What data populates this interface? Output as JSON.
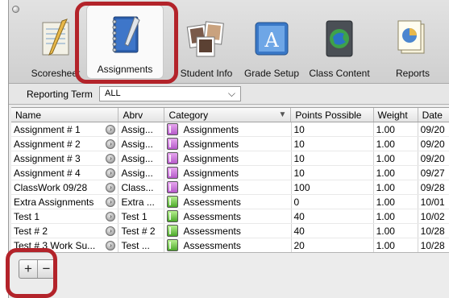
{
  "toolbar": {
    "items": [
      {
        "label": "Scoresheet",
        "icon": "scoresheet-icon"
      },
      {
        "label": "Assignments",
        "icon": "notebook-icon",
        "selected": true
      },
      {
        "label": "Student Info",
        "icon": "student-photos-icon"
      },
      {
        "label": "Grade Setup",
        "icon": "grade-setup-icon"
      },
      {
        "label": "Class Content",
        "icon": "class-content-icon"
      },
      {
        "label": "Reports",
        "icon": "reports-icon"
      }
    ]
  },
  "term": {
    "label": "Reporting Term",
    "value": "ALL"
  },
  "table": {
    "columns": [
      "Name",
      "Abrv",
      "Category",
      "Points Possible",
      "Weight",
      "Date"
    ],
    "rows": [
      {
        "name": "Assignment # 1",
        "abrv": "Assig...",
        "category": "Assignments",
        "points": "10",
        "weight": "1.00",
        "date": "09/20"
      },
      {
        "name": "Assignment # 2",
        "abrv": "Assig...",
        "category": "Assignments",
        "points": "10",
        "weight": "1.00",
        "date": "09/20"
      },
      {
        "name": "Assignment # 3",
        "abrv": "Assig...",
        "category": "Assignments",
        "points": "10",
        "weight": "1.00",
        "date": "09/20"
      },
      {
        "name": "Assignment # 4",
        "abrv": "Assig...",
        "category": "Assignments",
        "points": "10",
        "weight": "1.00",
        "date": "09/27"
      },
      {
        "name": "ClassWork 09/28",
        "abrv": "Class...",
        "category": "Assignments",
        "points": "100",
        "weight": "1.00",
        "date": "09/28"
      },
      {
        "name": "Extra Assignments",
        "abrv": "Extra ...",
        "category": "Assessments",
        "points": "0",
        "weight": "1.00",
        "date": "10/01"
      },
      {
        "name": "Test 1",
        "abrv": "Test 1",
        "category": "Assessments",
        "points": "40",
        "weight": "1.00",
        "date": "10/02"
      },
      {
        "name": "Test # 2",
        "abrv": "Test # 2",
        "category": "Assessments",
        "points": "40",
        "weight": "1.00",
        "date": "10/28"
      },
      {
        "name": "Test # 3 Work Su...",
        "abrv": "Test ...",
        "category": "Assessments",
        "points": "20",
        "weight": "1.00",
        "date": "10/28"
      }
    ]
  },
  "bottom": {
    "add_label": "+",
    "remove_label": "−"
  },
  "colors": {
    "highlight": "#b3232a",
    "assignments_category": "#b559c8",
    "assessments_category": "#4ca92a"
  }
}
